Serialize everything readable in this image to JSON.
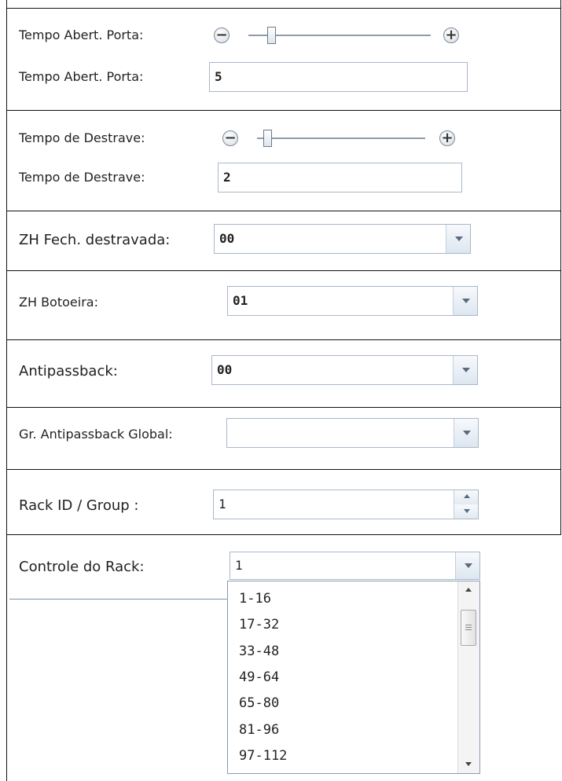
{
  "door_open_time": {
    "slider_label": "Tempo Abert. Porta:",
    "field_label": "Tempo Abert. Porta:",
    "value": "5",
    "slider_level": 0.11
  },
  "unlock_time": {
    "slider_label": "Tempo de Destrave:",
    "field_label": "Tempo de Destrave:",
    "value": "2",
    "slider_level": 0.04
  },
  "zh_fech_destravada": {
    "label": "ZH Fech. destravada:",
    "value": "00"
  },
  "zh_botoeira": {
    "label": "ZH Botoeira:",
    "value": "01"
  },
  "antipassback": {
    "label": "Antipassback:",
    "value": "00"
  },
  "gr_antipassback_global": {
    "label": "Gr. Antipassback Global:",
    "value": ""
  },
  "rack_id_group": {
    "label": "Rack ID / Group :",
    "value": "1"
  },
  "controle_do_rack": {
    "label": "Controle do Rack:",
    "value": "1",
    "options": [
      "1-16",
      "17-32",
      "33-48",
      "49-64",
      "65-80",
      "81-96",
      "97-112"
    ]
  },
  "icons": {
    "minus": "−",
    "plus": "+"
  }
}
